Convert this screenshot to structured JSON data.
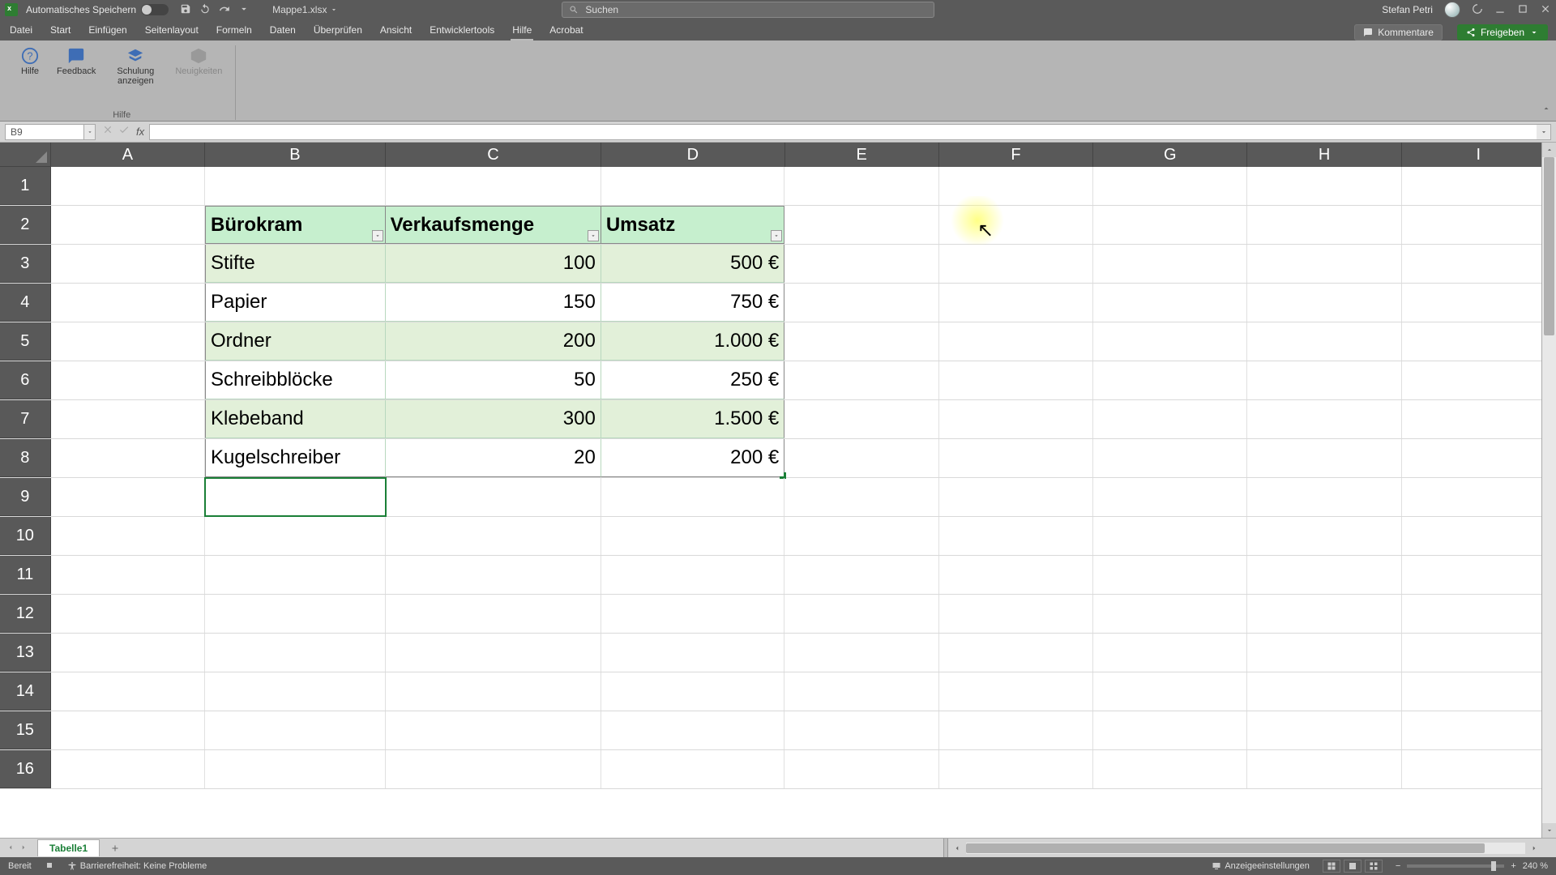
{
  "titlebar": {
    "autosave_label": "Automatisches Speichern",
    "filename": "Mappe1.xlsx",
    "search_placeholder": "Suchen",
    "username": "Stefan Petri"
  },
  "tabs": {
    "file": "Datei",
    "home": "Start",
    "insert": "Einfügen",
    "pagelayout": "Seitenlayout",
    "formulas": "Formeln",
    "data": "Daten",
    "review": "Überprüfen",
    "view": "Ansicht",
    "developer": "Entwicklertools",
    "help": "Hilfe",
    "acrobat": "Acrobat",
    "comments": "Kommentare",
    "share": "Freigeben"
  },
  "ribbon": {
    "help": "Hilfe",
    "feedback": "Feedback",
    "training": "Schulung anzeigen",
    "news": "Neuigkeiten",
    "group_label": "Hilfe"
  },
  "formula_bar": {
    "namebox": "B9",
    "fx": "fx",
    "value": ""
  },
  "columns": [
    "A",
    "B",
    "C",
    "D",
    "E",
    "F",
    "G",
    "H",
    "I"
  ],
  "row_labels": [
    "1",
    "2",
    "3",
    "4",
    "5",
    "6",
    "7",
    "8",
    "9",
    "10",
    "11",
    "12",
    "13",
    "14",
    "15",
    "16"
  ],
  "table": {
    "headers": {
      "b": "Bürokram",
      "c": "Verkaufsmenge",
      "d": "Umsatz"
    },
    "rows": [
      {
        "b": "Stifte",
        "c": "100",
        "d": "500 €"
      },
      {
        "b": "Papier",
        "c": "150",
        "d": "750 €"
      },
      {
        "b": "Ordner",
        "c": "200",
        "d": "1.000 €"
      },
      {
        "b": "Schreibblöcke",
        "c": "50",
        "d": "250 €"
      },
      {
        "b": "Klebeband",
        "c": "300",
        "d": "1.500 €"
      },
      {
        "b": "Kugelschreiber",
        "c": "20",
        "d": "200 €"
      }
    ]
  },
  "sheets": {
    "tab1": "Tabelle1"
  },
  "statusbar": {
    "ready": "Bereit",
    "accessibility": "Barrierefreiheit: Keine Probleme",
    "display_settings": "Anzeigeeinstellungen",
    "zoom": "240 %"
  }
}
